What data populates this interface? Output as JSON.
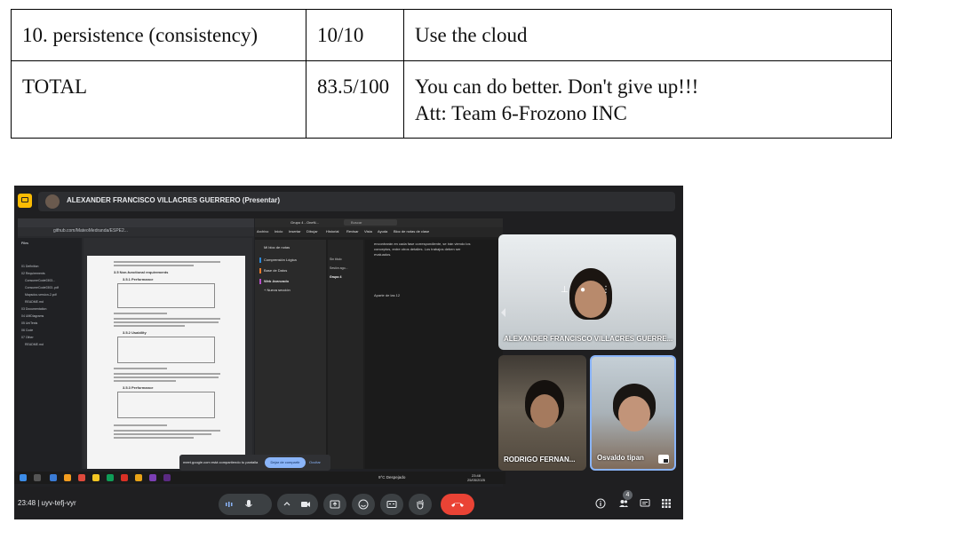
{
  "table": {
    "rows": [
      {
        "criterion": "10. persistence (consistency)",
        "score": "10/10",
        "comment_lines": [
          "Use the cloud"
        ]
      },
      {
        "criterion": "TOTAL",
        "score": "83.5/100",
        "comment_lines": [
          "You can do better. Don't give up!!!",
          "Att: Team 6-Frozono INC"
        ]
      }
    ]
  },
  "meet": {
    "presenter_label": "ALEXANDER FRANCISCO VILLACRES GUERRERO (Presentar)",
    "meeting_code": "23:48  |  uyv-tefj-vyr",
    "participants_count": "4",
    "tiles": [
      {
        "name": "ALEXANDER FRANCISCO VILLACRES GUERRE..."
      },
      {
        "name": "RODRIGO FERNAN..."
      },
      {
        "name": "Osvaldo tipan"
      }
    ],
    "share_popup": {
      "text": "meet.google.com está compartiendo tu pantalla",
      "stop_button": "Dejar de compartir",
      "hide_link": "Ocultar"
    },
    "colors": {
      "end_call": "#ea4335",
      "accent": "#8ab4f8",
      "present": "#fbbc04"
    }
  },
  "desktop": {
    "browser_url": "github.com/MateoMedranda/ESPE2...",
    "files_title": "Files",
    "files": [
      "01 Definition",
      "02 Requirements",
      "ConsumeCode0303...",
      "ConsumeCode0303..pdf",
      "Mapsdoc-version-2.pdf",
      "README.md",
      "03 Documentation",
      "04 UMDiagrams",
      "05 UniTests",
      "06 Code",
      "07 Other",
      "README.md"
    ],
    "doc_heading_1": "3.5  Non-functional requirements",
    "doc_heading_2": "3.5.1  Performance",
    "doc_heading_3": "3.5.2  Usability",
    "doc_heading_4": "3.5.3  Performance",
    "onenote_menu": [
      "Archivo",
      "Inicio",
      "Insertar",
      "Dibujar",
      "Historial",
      "Revisar",
      "Vista",
      "Ayuda",
      "Bloc de notas de clase"
    ],
    "onenote_title": "Grupo 4 - OneN...",
    "onenote_search": "Buscar",
    "onenote_notebook": "Mi bloc de notas",
    "onenote_sections": [
      "Comprensión Lógica",
      "Base de Datos",
      "Web Avanzado"
    ],
    "onenote_new_section": "+ Nueva sección",
    "onenote_pages": [
      "Sin título",
      "Sesión ago...",
      "Grupo 4"
    ],
    "onenote_note_1": "encontrarán en cada fase correspondiente, se irán viendo los conceptos, entre otros detalles. Los trabajos deben ser evaluados.",
    "onenote_note_2": "Aparte de las 12",
    "weather": "9°C  Despejado",
    "clock_time": "23:48",
    "clock_date": "25/05/2025"
  }
}
